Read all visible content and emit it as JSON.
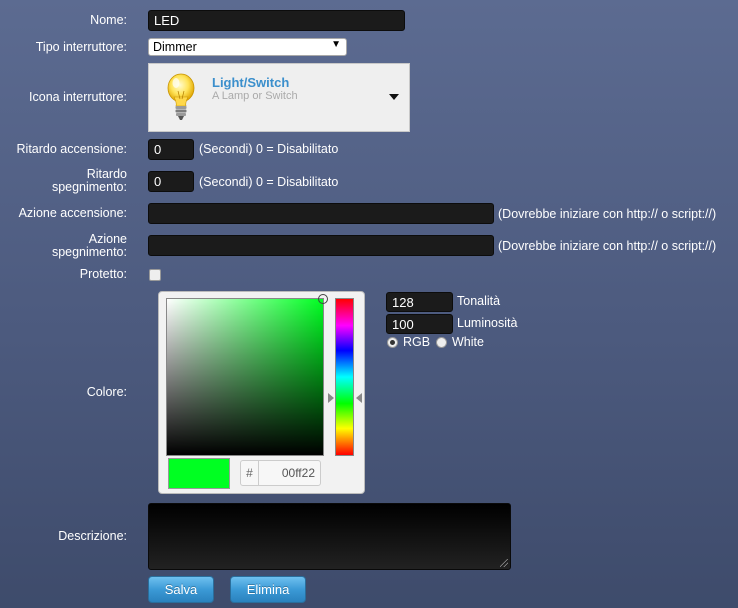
{
  "form": {
    "name": {
      "label": "Nome:",
      "value": "LED"
    },
    "switch_type": {
      "label": "Tipo interruttore:",
      "value": "Dimmer"
    },
    "switch_icon": {
      "label": "Icona interruttore:",
      "title": "Light/Switch",
      "subtitle": "A Lamp or Switch",
      "icon": "light-bulb-icon"
    },
    "on_delay": {
      "label": "Ritardo accensione:",
      "value": "0",
      "note": "(Secondi) 0 = Disabilitato"
    },
    "off_delay": {
      "label_line1": "Ritardo",
      "label_line2": "spegnimento:",
      "value": "0",
      "note": "(Secondi) 0 = Disabilitato"
    },
    "on_action": {
      "label": "Azione accensione:",
      "value": "",
      "note": "(Dovrebbe iniziare con http:// o script://)"
    },
    "off_action": {
      "label_line1": "Azione",
      "label_line2": "spegnimento:",
      "value": "",
      "note": "(Dovrebbe iniziare con http:// o script://)"
    },
    "protected": {
      "label": "Protetto:",
      "checked": false
    },
    "color": {
      "label": "Colore:",
      "hex_prefix": "#",
      "hex": "00ff22",
      "swatch_color": "#00ff22",
      "hue_value": "128",
      "hue_label": "Tonalità",
      "brightness_value": "100",
      "brightness_label": "Luminosità",
      "mode_options": [
        "RGB",
        "White"
      ],
      "mode_selected": "RGB"
    },
    "description": {
      "label": "Descrizione:",
      "value": ""
    },
    "buttons": {
      "save": "Salva",
      "delete": "Elimina"
    }
  },
  "colors": {
    "button": "#3b9ad6",
    "link_title": "#3b8fcc",
    "background": "#5c6b91"
  }
}
